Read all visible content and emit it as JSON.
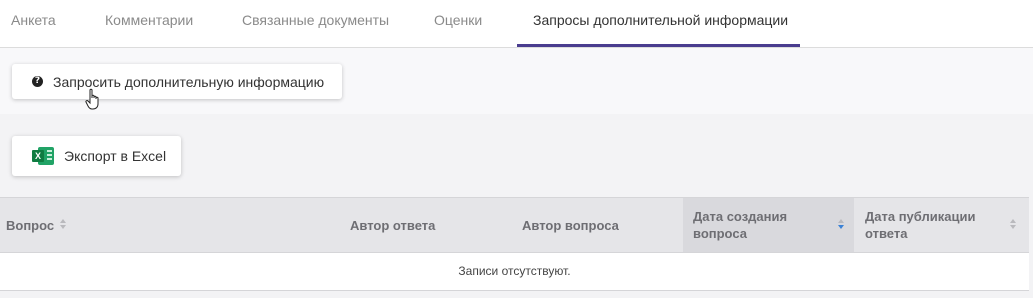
{
  "tabs": [
    {
      "label": "Анкета"
    },
    {
      "label": "Комментарии"
    },
    {
      "label": "Связанные документы"
    },
    {
      "label": "Оценки"
    },
    {
      "label": "Запросы дополнительной информации",
      "active": true
    }
  ],
  "toolbar": {
    "request_label": "Запросить дополнительную информацию",
    "request_icon": "question-circle-icon",
    "export_label": "Экспорт в Excel",
    "export_icon": "excel-icon"
  },
  "table": {
    "columns": [
      {
        "label": "Вопрос",
        "sortable": true
      },
      {
        "label": "Автор ответа",
        "sortable": false
      },
      {
        "label": "Автор вопроса",
        "sortable": false
      },
      {
        "label": "Дата создания вопроса",
        "sortable": true,
        "sort": "desc"
      },
      {
        "label": "Дата публикации ответа",
        "sortable": true
      }
    ],
    "empty_message": "Записи отсутствуют."
  },
  "colors": {
    "accent": "#4a3d8f",
    "sort_active": "#3b82d6",
    "excel": "#107c41"
  }
}
